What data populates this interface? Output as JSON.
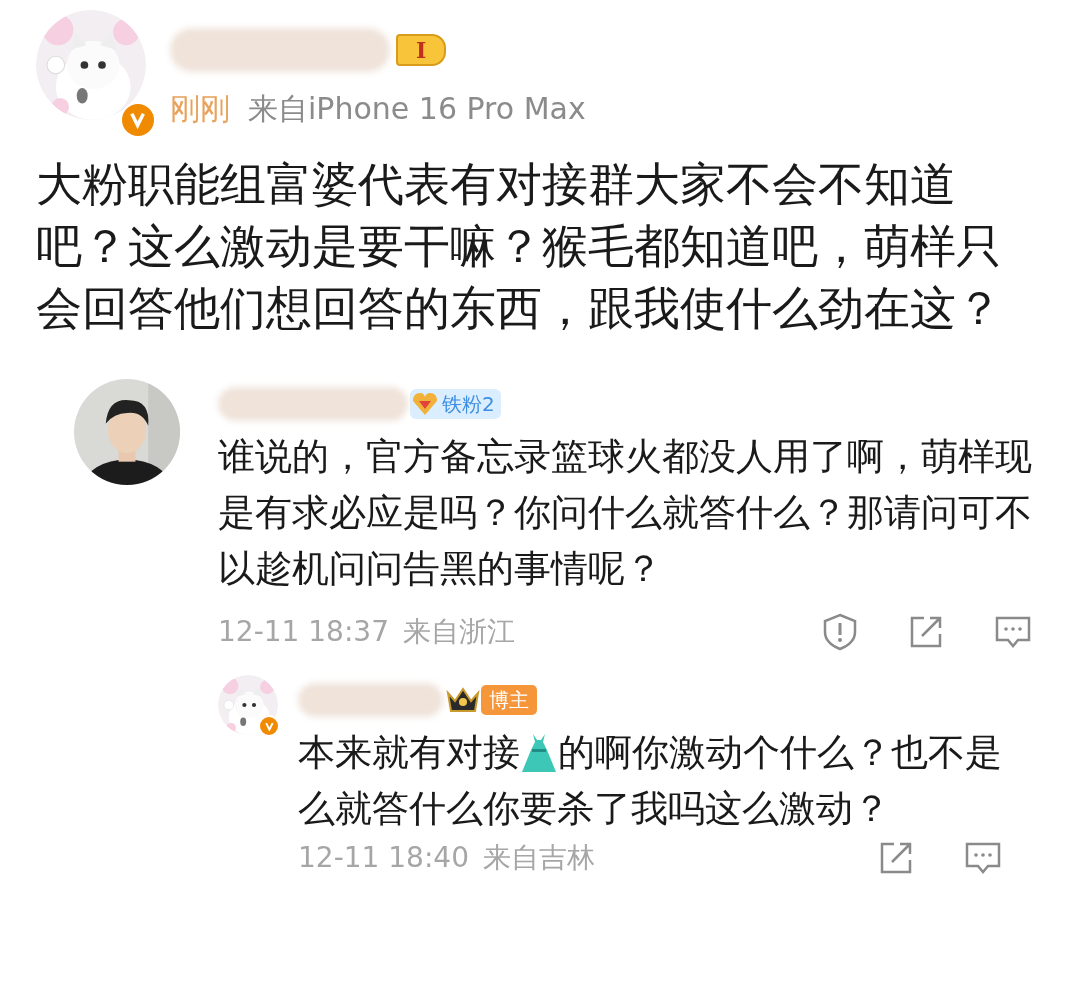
{
  "post": {
    "badge_level": "I",
    "time": "刚刚",
    "source": "来自iPhone 16 Pro Max",
    "verified": true,
    "text": "大粉职能组富婆代表有对接群大家不会不知道吧？这么激动是要干嘛？猴毛都知道吧，萌样只会回答他们想回答的东西，跟我使什么劲在这？"
  },
  "comments": [
    {
      "badge": {
        "kind": "fan",
        "label": "铁粉2"
      },
      "verified": false,
      "can_report": true,
      "nested": false,
      "lines": [
        [
          {
            "kind": "text",
            "text": "谁说的，官方备忘录篮球火都没人用了啊，萌样现"
          }
        ],
        [
          {
            "kind": "text",
            "text": "是有求必应是吗？你问什么就答什么？那请问可不"
          }
        ],
        [
          {
            "kind": "text",
            "text": "以趁机问问告黑的事情呢？"
          }
        ]
      ],
      "date": "12-11 18:37",
      "location": "来自浙江"
    },
    {
      "badge": {
        "kind": "author",
        "label": "博主"
      },
      "verified": true,
      "can_report": false,
      "nested": true,
      "lines": [
        [
          {
            "kind": "text",
            "text": "本来就有对接"
          },
          {
            "kind": "emoji"
          },
          {
            "kind": "text",
            "text": "的啊你激动个什么？也不是"
          }
        ],
        [
          {
            "kind": "text",
            "text": "么就答什么你要杀了我吗这么激动？"
          }
        ]
      ],
      "date": "12-11 18:40",
      "location": "来自吉林"
    }
  ]
}
